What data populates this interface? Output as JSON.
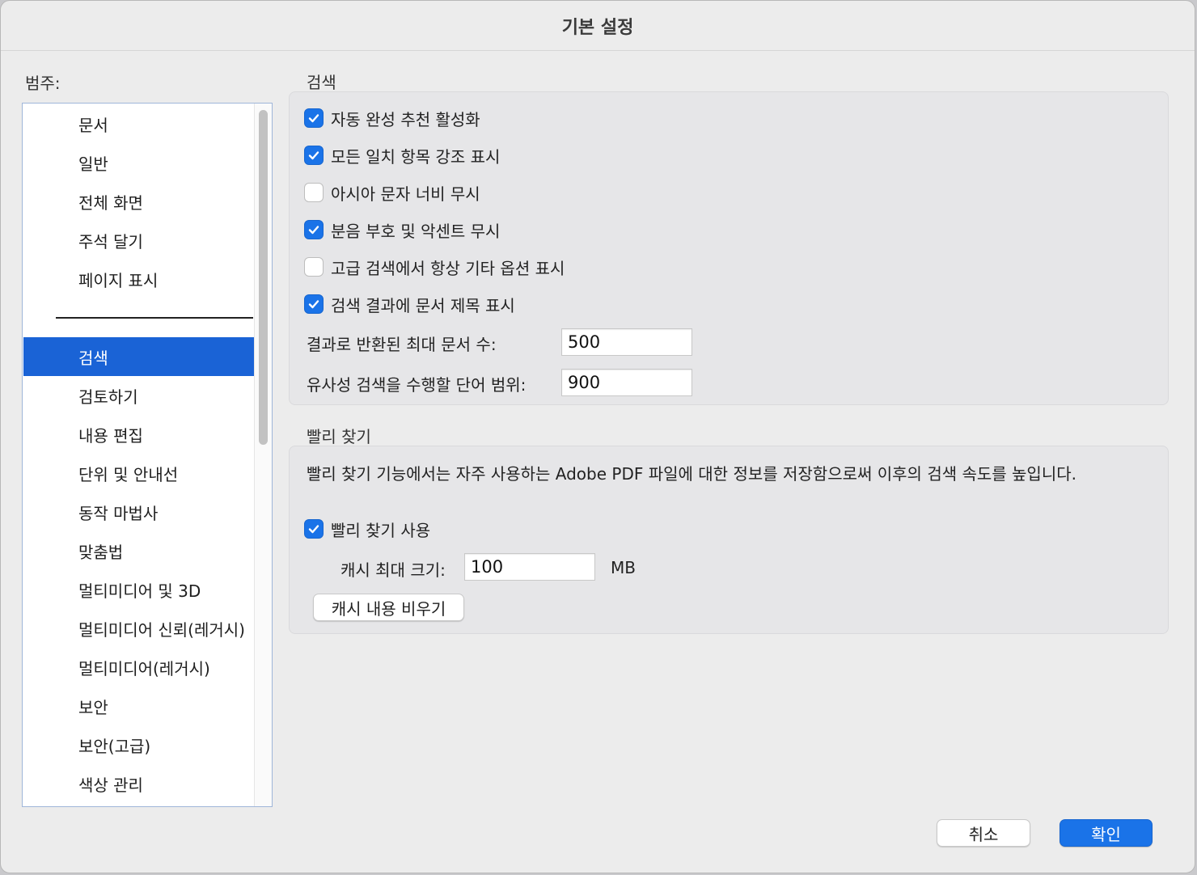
{
  "window": {
    "title": "기본 설정"
  },
  "categories": {
    "label": "범주:",
    "items_top": [
      "문서",
      "일반",
      "전체 화면",
      "주석 달기",
      "페이지 표시"
    ],
    "items_bottom": [
      "검색",
      "검토하기",
      "내용 편집",
      "단위 및 안내선",
      "동작 마법사",
      "맞춤법",
      "멀티미디어 및 3D",
      "멀티미디어 신뢰(레거시)",
      "멀티미디어(레거시)",
      "보안",
      "보안(고급)",
      "색상 관리"
    ],
    "selected": "검색"
  },
  "search": {
    "title": "검색",
    "options": [
      {
        "label": "자동 완성 추천 활성화",
        "checked": true
      },
      {
        "label": "모든 일치 항목 강조 표시",
        "checked": true
      },
      {
        "label": "아시아 문자 너비 무시",
        "checked": false
      },
      {
        "label": "분음 부호 및 악센트 무시",
        "checked": true
      },
      {
        "label": "고급 검색에서 항상 기타 옵션 표시",
        "checked": false
      },
      {
        "label": "검색 결과에 문서 제목 표시",
        "checked": true
      }
    ],
    "max_docs_label": "결과로 반환된 최대 문서 수:",
    "max_docs_value": "500",
    "proximity_label": "유사성 검색을 수행할 단어 범위:",
    "proximity_value": "900"
  },
  "fast_find": {
    "title": "빨리 찾기",
    "description": "빨리 찾기 기능에서는 자주 사용하는 Adobe PDF 파일에 대한 정보를 저장함으로써 이후의 검색 속도를 높입니다.",
    "enable_label": "빨리 찾기 사용",
    "enable_checked": true,
    "cache_label": "캐시 최대 크기:",
    "cache_value": "100",
    "cache_unit": "MB",
    "clear_button": "캐시 내용 비우기"
  },
  "footer": {
    "cancel": "취소",
    "ok": "확인"
  },
  "colors": {
    "accent": "#1a73e8",
    "selection": "#1a63d6"
  }
}
